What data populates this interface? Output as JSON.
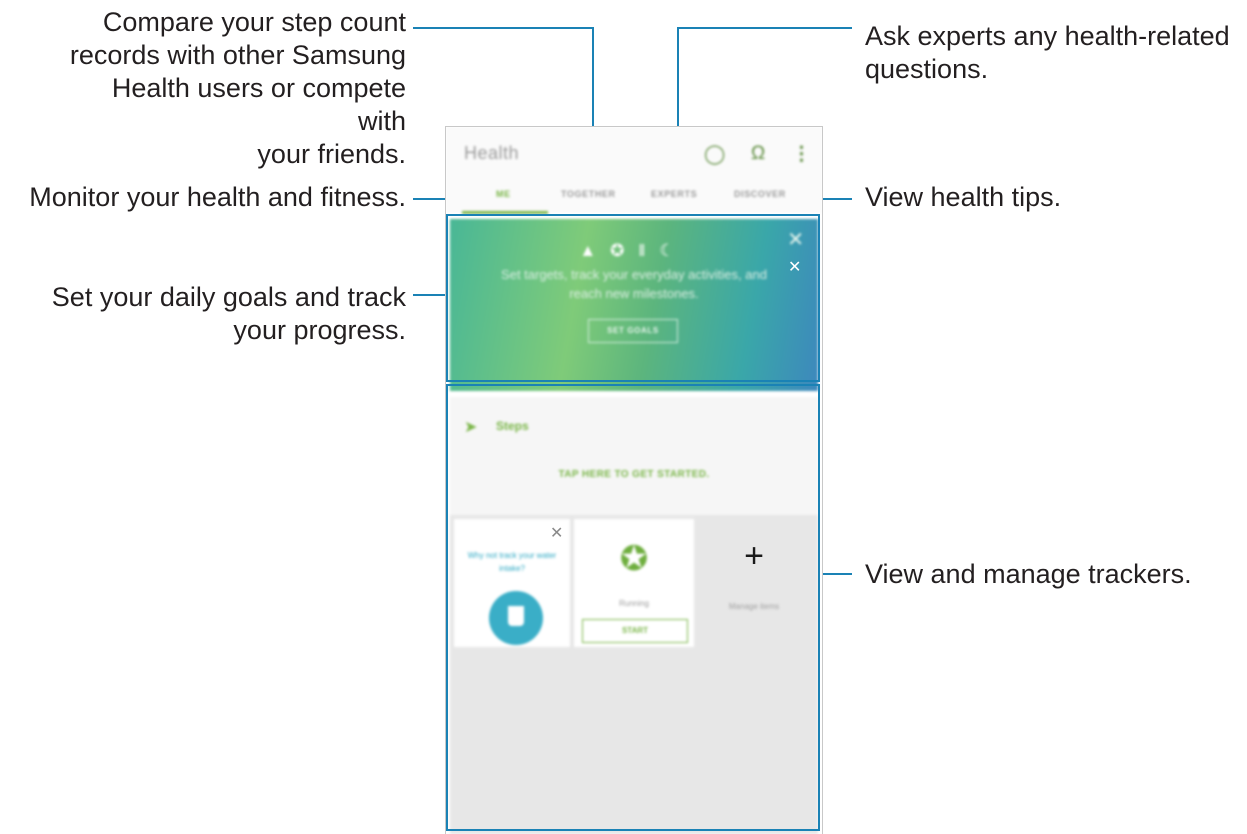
{
  "callouts": {
    "compare": [
      "Compare your step count",
      "records with other Samsung",
      "Health users or compete with",
      "your friends."
    ],
    "experts": [
      "Ask experts any health-related",
      "questions."
    ],
    "monitor": "Monitor your health and fitness.",
    "tips": "View health tips.",
    "goals": [
      "Set your daily goals and track",
      "your progress."
    ],
    "trackers": "View and manage trackers."
  },
  "app": {
    "title": "Health",
    "icons": {
      "tips": "lightbulb-icon",
      "profile": "person-icon",
      "more": "more-vert-icon"
    },
    "tabs": [
      "ME",
      "TOGETHER",
      "EXPERTS",
      "DISCOVER"
    ],
    "active_tab": "ME"
  },
  "banner": {
    "icons": [
      "shoe-icon",
      "running-icon",
      "fork-knife-icon",
      "moon-icon"
    ],
    "text": "Set targets, track your everyday activities, and reach new milestones.",
    "button": "SET GOALS"
  },
  "steps": {
    "label": "Steps",
    "cta": "TAP HERE TO GET STARTED."
  },
  "trackers": {
    "water_prompt": "Why not track your water intake?",
    "running_label": "Running",
    "start_button": "START",
    "manage_label": "Manage items"
  },
  "colors": {
    "accent_green": "#7ab648",
    "callout_line": "#1a82b5",
    "water_blue": "#3aaec7"
  }
}
